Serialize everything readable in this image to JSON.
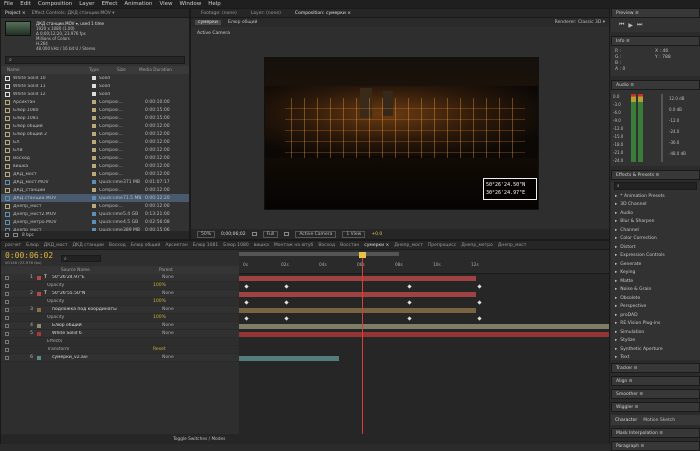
{
  "menu": [
    "File",
    "Edit",
    "Composition",
    "Layer",
    "Effect",
    "Animation",
    "View",
    "Window",
    "Help"
  ],
  "project": {
    "tabs": [
      "Project ×",
      "Effect Controls: ДКД станции.MOV ▾"
    ],
    "file_name": "ДКД станции.MOV ▾, used 1 time",
    "info_lines": [
      "1920 x 1080 (1.00)",
      "Δ 0;00;12;20, 23.976 fps",
      "Millions of Colors",
      "H.264",
      "48.000 kHz / 16 bit U / Stereo"
    ],
    "columns": [
      "Name",
      "Type",
      "Size",
      "Media Duration"
    ],
    "items": [
      {
        "name": "White Solid 10",
        "type": "Solid",
        "size": "",
        "dur": "",
        "color": "#dddddd"
      },
      {
        "name": "White Solid 11",
        "type": "Solid",
        "size": "",
        "dur": "",
        "color": "#dddddd"
      },
      {
        "name": "White Solid 12",
        "type": "Solid",
        "size": "",
        "dur": "",
        "color": "#dddddd"
      },
      {
        "name": "Арсиктан",
        "type": "Composi...",
        "size": "",
        "dur": "0:00:10:00",
        "color": "#b9a97b"
      },
      {
        "name": "Блюр 1080",
        "type": "Composi...",
        "size": "",
        "dur": "0:00:15:00",
        "color": "#b9a97b"
      },
      {
        "name": "Блюр 1081",
        "type": "Composi...",
        "size": "",
        "dur": "0:00:15:00",
        "color": "#b9a97b"
      },
      {
        "name": "Блюр общий",
        "type": "Composi...",
        "size": "",
        "dur": "0:00:12:00",
        "color": "#b9a97b"
      },
      {
        "name": "Блюр общий 2",
        "type": "Composi...",
        "size": "",
        "dur": "0:00:12:00",
        "color": "#b9a97b"
      },
      {
        "name": "БЛ",
        "type": "Composi...",
        "size": "",
        "dur": "0:00:12:00",
        "color": "#b9a97b"
      },
      {
        "name": "БЛВ",
        "type": "Composi...",
        "size": "",
        "dur": "0:00:12:00",
        "color": "#b9a97b"
      },
      {
        "name": "Восход",
        "type": "Composi...",
        "size": "",
        "dur": "0:00:12:00",
        "color": "#b9a97b"
      },
      {
        "name": "вишка",
        "type": "Composi...",
        "size": "",
        "dur": "0:00:12:00",
        "color": "#b9a97b"
      },
      {
        "name": "ДКД_мост",
        "type": "Composi...",
        "size": "",
        "dur": "0:00:12:00",
        "color": "#b9a97b"
      },
      {
        "name": "ДКД_мост.MOV",
        "type": "QuickTime",
        "size": "371 MB",
        "dur": "0:01:07:17",
        "color": "#5d8fb6"
      },
      {
        "name": "ДКД_станции",
        "type": "Composi...",
        "size": "",
        "dur": "0:00:12:00",
        "color": "#b9a97b"
      },
      {
        "name": "ДКД станции.MOV",
        "type": "QuickTime",
        "size": "71.5 MB",
        "dur": "0:00:12:20",
        "color": "#5d8fb6"
      },
      {
        "name": "Днепр_мост",
        "type": "Composi...",
        "size": "",
        "dur": "0:00:12:00",
        "color": "#b9a97b"
      },
      {
        "name": "Днепр_мост2.MOV",
        "type": "QuickTime",
        "size": "5.4 GB",
        "dur": "0:13:21:00",
        "color": "#5d8fb6"
      },
      {
        "name": "Днепр_метро.MOV",
        "type": "QuickTime",
        "size": "4.5 GB",
        "dur": "0:02:56:08",
        "color": "#5d8fb6"
      },
      {
        "name": "Днепр_мост",
        "type": "QuickTime",
        "size": "389 MB",
        "dur": "0:00:15:06",
        "color": "#5d8fb6"
      }
    ],
    "bpc": "8 bpc"
  },
  "viewer": {
    "tabs": [
      "Footage: (none)",
      "Layer: (none)",
      "Composition: сумерки ×"
    ],
    "subtabs": [
      "сумерки",
      "Блюр общий"
    ],
    "renderer": "Renderer: Classic 3D ▾",
    "camera_label": "Active Camera",
    "footer": [
      "50%",
      "0;00;06;02",
      "Full",
      "Active Camera",
      "1 View",
      "+0.0"
    ],
    "overlay_line1": "50°26'24.50\"N",
    "overlay_line2": "30°26'24.97\"E"
  },
  "timeline": {
    "tabs": [
      "расчет",
      "Блюр",
      "ДКД_мост",
      "ДКД станции",
      "Восход",
      "Блюр общий",
      "Арсиктан",
      "Блюр 1081",
      "Блюр 1080",
      "вишка",
      "Монтаж на ютуб",
      "Восход",
      "Восстан",
      "сумерки ×",
      "Днепр_мост",
      "Препроцесс",
      "Днепр_метро",
      "Днепр_мост"
    ],
    "timecode": "0:00:06:02",
    "frames": "00146 (23.976 fps)",
    "search_placeholder": "⌕",
    "col_header": "Source Name",
    "parent_header": "Parent",
    "ruler": [
      "0s",
      "02s",
      "04s",
      "06s",
      "08s",
      "10s",
      "12s"
    ],
    "toggle_label": "Toggle Switches / Modes",
    "layers": [
      {
        "num": "1",
        "name": "50°26'24.97\"E",
        "kind": "T",
        "sub": false,
        "parent": "None",
        "bar": "#b54848",
        "start": 0.0,
        "end": 0.64,
        "kfs": []
      },
      {
        "num": "",
        "name": "Opacity",
        "kind": "",
        "sub": true,
        "parent": "100%",
        "bar": "",
        "start": 0,
        "end": 0,
        "kfs": [
          0.01,
          0.12,
          0.45,
          0.64
        ]
      },
      {
        "num": "2",
        "name": "50°26'55.50\"N",
        "kind": "T",
        "sub": false,
        "parent": "None",
        "bar": "#b54848",
        "start": 0.0,
        "end": 0.64,
        "kfs": []
      },
      {
        "num": "",
        "name": "Opacity",
        "kind": "",
        "sub": true,
        "parent": "100%",
        "bar": "",
        "start": 0,
        "end": 0,
        "kfs": [
          0.01,
          0.12,
          0.45,
          0.64
        ]
      },
      {
        "num": "3",
        "name": "подложка под координаты",
        "kind": "",
        "sub": false,
        "parent": "None",
        "bar": "#8a6e46",
        "start": 0.0,
        "end": 0.64,
        "kfs": []
      },
      {
        "num": "",
        "name": "Opacity",
        "kind": "",
        "sub": true,
        "parent": "100%",
        "bar": "",
        "start": 0,
        "end": 0,
        "kfs": [
          0.01,
          0.12,
          0.45,
          0.64
        ]
      },
      {
        "num": "4",
        "name": "Блюр общий",
        "kind": "",
        "sub": false,
        "parent": "None",
        "bar": "#8d8d74",
        "start": 0.0,
        "end": 1.0,
        "kfs": []
      },
      {
        "num": "5",
        "name": "White Solid 6",
        "kind": "",
        "sub": false,
        "parent": "None",
        "bar": "#a83838",
        "start": 0.0,
        "end": 1.0,
        "kfs": []
      },
      {
        "num": "",
        "name": "Effects",
        "kind": "",
        "sub": true,
        "parent": "",
        "bar": "",
        "start": 0,
        "end": 0,
        "kfs": []
      },
      {
        "num": "",
        "name": "Transform",
        "kind": "",
        "sub": true,
        "parent": "Reset",
        "bar": "",
        "start": 0,
        "end": 0,
        "kfs": []
      },
      {
        "num": "6",
        "name": "сумерки_v2.avi",
        "kind": "",
        "sub": false,
        "parent": "None",
        "bar": "#5b8d8a",
        "start": 0.0,
        "end": 0.27,
        "kfs": []
      }
    ]
  },
  "right": {
    "preview": "Preview ≡",
    "info": "Info ≡",
    "info_lines": [
      "R :",
      "G :",
      "B :",
      "A : 0"
    ],
    "info_xy": [
      "X : 46",
      "Y : 788"
    ],
    "audio": "Audio ≡",
    "audio_scale": [
      "0.0",
      "-3.0",
      "-6.0",
      "-9.0",
      "-12.0",
      "-15.0",
      "-18.0",
      "-21.0",
      "-24.0"
    ],
    "audio_db": [
      "12.0 dB",
      "0.0 dB",
      "-12.0",
      "-24.0",
      "-36.0",
      "-48.0 dB"
    ],
    "fx_title": "Effects & Presets ≡",
    "fx_search": "⌕",
    "fx_items": [
      "* Animation Presets",
      "3D Channel",
      "Audio",
      "Blur & Sharpen",
      "Channel",
      "Color Correction",
      "Distort",
      "Expression Controls",
      "Generate",
      "Keying",
      "Matte",
      "Noise & Grain",
      "Obsolete",
      "Perspective",
      "proDAD",
      "RE:Vision Plug-ins",
      "Simulation",
      "Stylize",
      "Synthetic Aperture",
      "Text"
    ],
    "panels": [
      "Tracker ≡",
      "Align ≡",
      "Smoother ≡",
      "Wiggler ≡"
    ],
    "character": [
      "Character",
      "Motion Sketch"
    ],
    "mask": "Mask Interpolation ≡",
    "paragraph": "Paragraph ≡"
  }
}
